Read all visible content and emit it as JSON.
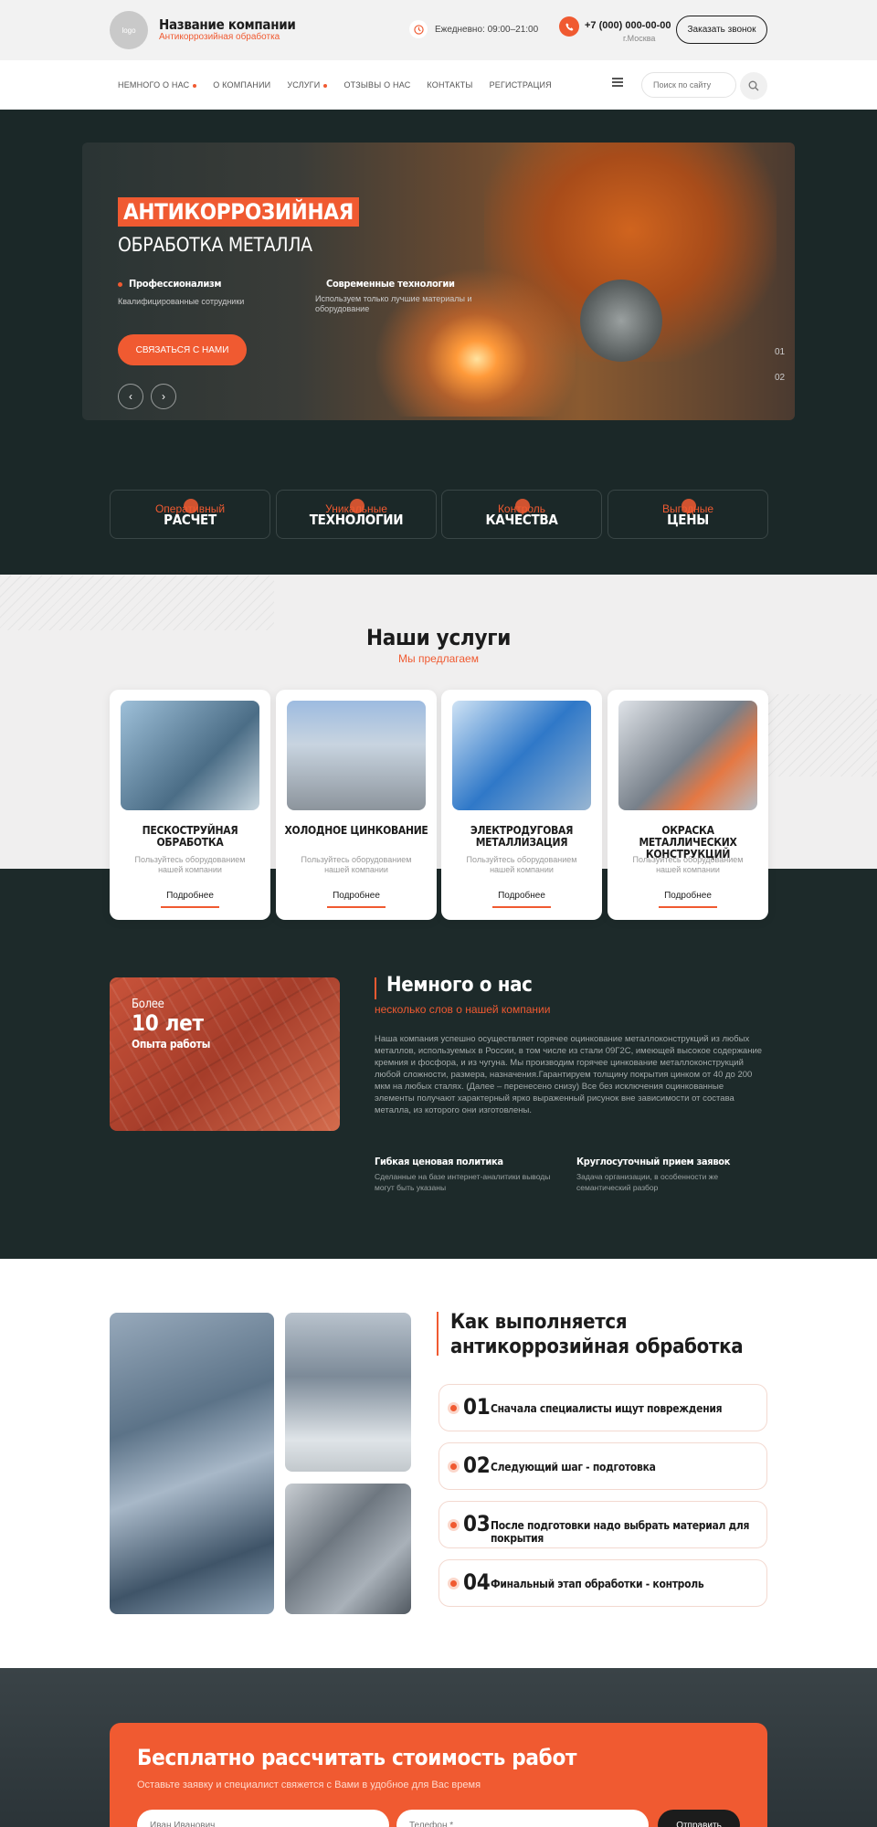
{
  "header": {
    "logo_text": "logo",
    "company_name": "Название компании",
    "company_subtitle": "Антикоррозийная обработка",
    "hours": "Ежедневно: 09:00–21:00",
    "phone": "+7 (000) 000-00-00",
    "city": "г.Москва",
    "callback_label": "Заказать звонок"
  },
  "nav": {
    "items": [
      {
        "label": "Немного о нас",
        "dropdown": true
      },
      {
        "label": "О компании",
        "dropdown": false
      },
      {
        "label": "Услуги",
        "dropdown": true
      },
      {
        "label": "Отзывы о нас",
        "dropdown": false
      },
      {
        "label": "Контакты",
        "dropdown": false
      },
      {
        "label": "Регистрация",
        "dropdown": false
      }
    ],
    "search_placeholder": "Поиск по сайту"
  },
  "hero": {
    "badge": "АНТИКОРРОЗИЙНАЯ",
    "title": "ОБРАБОТКА МЕТАЛЛА",
    "feature1_title": "Профессионализм",
    "feature1_text": "Квалифицированные сотрудники",
    "feature2_title": "Современные технологии",
    "feature2_text": "Используем только лучшие материалы и оборудование",
    "cta": "СВЯЗАТЬСЯ С НАМИ",
    "prev": "‹",
    "next": "›",
    "page1": "01",
    "page2": "02"
  },
  "advantages": [
    {
      "small": "Оперативный",
      "big": "РАСЧЕТ"
    },
    {
      "small": "Уникальные",
      "big": "ТЕХНОЛОГИИ"
    },
    {
      "small": "Контроль",
      "big": "КАЧЕСТВА"
    },
    {
      "small": "Выгодные",
      "big": "ЦЕНЫ"
    }
  ],
  "services": {
    "title": "Наши услуги",
    "subtitle": "Мы предлагаем",
    "items": [
      {
        "title": "ПЕСКОСТРУЙНАЯ ОБРАБОТКА",
        "text": "Пользуйтесь оборудованием нашей компании",
        "more": "Подробнее"
      },
      {
        "title": "ХОЛОДНОЕ ЦИНКОВАНИЕ",
        "text": "Пользуйтесь оборудованием нашей компании",
        "more": "Подробнее"
      },
      {
        "title": "ЭЛЕКТРОДУГОВАЯ МЕТАЛЛИЗАЦИЯ",
        "text": "Пользуйтесь оборудованием нашей компании",
        "more": "Подробнее"
      },
      {
        "title": "ОКРАСКА МЕТАЛЛИЧЕСКИХ КОНСТРУКЦИЙ",
        "text": "Пользуйтесь оборудованием нашей компании",
        "more": "Подробнее"
      }
    ]
  },
  "about": {
    "more": "Более",
    "years": "10 лет",
    "experience": "Опыта работы",
    "title": "Немного о нас",
    "subtitle": "несколько слов о нашей компании",
    "text": "Наша компания успешно осуществляет горячее оцинкование металлоконструкций из любых металлов, используемых в России, в том числе из стали 09Г2С, имеющей высокое содержание кремния и фосфора, и из чугуна. Мы производим горячее цинкование металлоконструкций любой сложности, размера, назначения.Гарантируем толщину покрытия цинком от 40 до 200 мкм на любых сталях. (Далее – перенесено снизу) Все без исключения оцинкованные элементы получают характерный ярко выраженный рисунок вне зависимости от состава металла, из которого они изготовлены.",
    "feature1_title": "Гибкая ценовая политика",
    "feature1_text": "Сделанные на базе интернет-аналитики выводы могут быть указаны",
    "feature2_title": "Круглосуточный прием заявок",
    "feature2_text": "Задача организации, в особенности же семантический разбор"
  },
  "process": {
    "title_line1": "Как выполняется",
    "title_line2": "антикоррозийная обработка",
    "steps": [
      {
        "num": "01",
        "text": "Сначала специалисты ищут повреждения"
      },
      {
        "num": "02",
        "text": "Следующий шаг - подготовка"
      },
      {
        "num": "03",
        "text": "После подготовки надо выбрать материал для покрытия"
      },
      {
        "num": "04",
        "text": "Финальный этап обработки - контроль"
      }
    ]
  },
  "form": {
    "title": "Бесплатно рассчитать стоимость работ",
    "subtitle": "Оставьте заявку и специалист свяжется с Вами в удобное для Вас время",
    "name_placeholder": "Иван Иванович",
    "phone_placeholder": "Телефон *",
    "submit": "Отправить"
  },
  "colors": {
    "accent": "#f05a31",
    "dark": "#1b2828"
  }
}
